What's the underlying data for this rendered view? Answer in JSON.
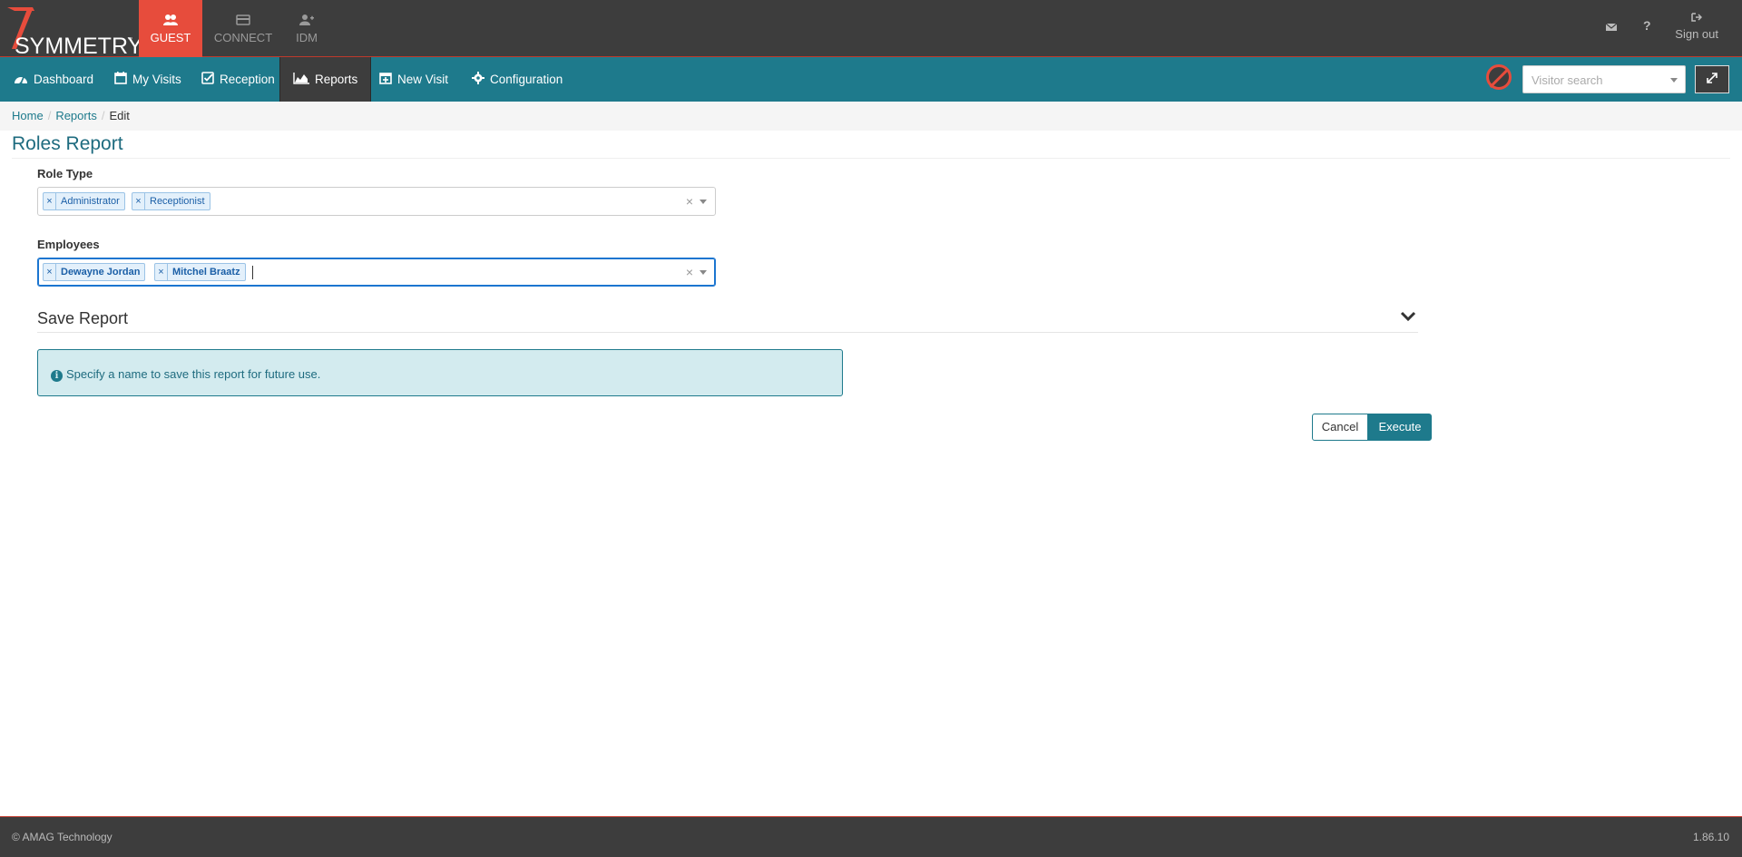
{
  "brand": {
    "name": "SYMMETRY",
    "tm": "™"
  },
  "app_tabs": [
    {
      "label": "GUEST",
      "icon": "users-icon",
      "active": true
    },
    {
      "label": "CONNECT",
      "icon": "card-icon",
      "active": false
    },
    {
      "label": "IDM",
      "icon": "user-add-icon",
      "active": false
    }
  ],
  "header_right": {
    "mail_icon": "envelope-icon",
    "help_label": "?",
    "signout_label": "Sign out"
  },
  "nav": [
    {
      "label": "Dashboard",
      "icon": "tachometer-icon"
    },
    {
      "label": "My Visits",
      "icon": "calendar-icon"
    },
    {
      "label": "Reception",
      "icon": "check-square-icon"
    },
    {
      "label": "Reports",
      "icon": "area-chart-icon",
      "active": true
    },
    {
      "label": "New Visit",
      "icon": "calendar-plus-icon"
    },
    {
      "label": "Configuration",
      "icon": "gear-icon"
    }
  ],
  "visitor_search": {
    "placeholder": "Visitor search"
  },
  "breadcrumb": {
    "home": "Home",
    "reports": "Reports",
    "current": "Edit",
    "separator": "/"
  },
  "page": {
    "title": "Roles Report"
  },
  "role_type": {
    "label": "Role Type",
    "selected": [
      "Administrator",
      "Receptionist"
    ],
    "clear": "×"
  },
  "employees": {
    "label": "Employees",
    "selected": [
      "Dewayne Jordan",
      "Mitchel Braatz"
    ],
    "clear": "×"
  },
  "save_report": {
    "heading": "Save Report",
    "info_icon": "i",
    "info_text": "Specify a name to save this report for future use."
  },
  "actions": {
    "cancel": "Cancel",
    "execute": "Execute"
  },
  "footer": {
    "copyright": "© AMAG Technology",
    "version": "1.86.10"
  },
  "colors": {
    "accent": "#1e7a8c",
    "header": "#3d3d3d",
    "brand_red": "#e74c3c"
  }
}
